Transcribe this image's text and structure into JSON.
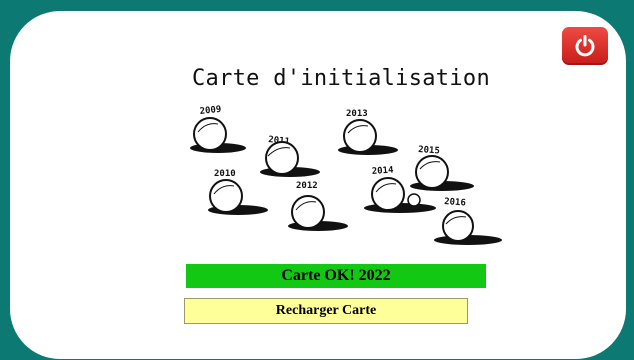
{
  "colors": {
    "frame": "#0c7a72",
    "card": "#ffffff",
    "power_button": "#d9302b",
    "status_ok": "#12c812",
    "reload_button": "#ffff99"
  },
  "header": {
    "power_icon": "power-icon"
  },
  "card": {
    "title": "Carte d'initialisation"
  },
  "illustration": {
    "years": [
      "2009",
      "2011",
      "2013",
      "2015",
      "2010",
      "2012",
      "2014",
      "2016"
    ]
  },
  "status": {
    "text": "Carte OK! 2022"
  },
  "actions": {
    "reload_label": "Recharger Carte"
  }
}
